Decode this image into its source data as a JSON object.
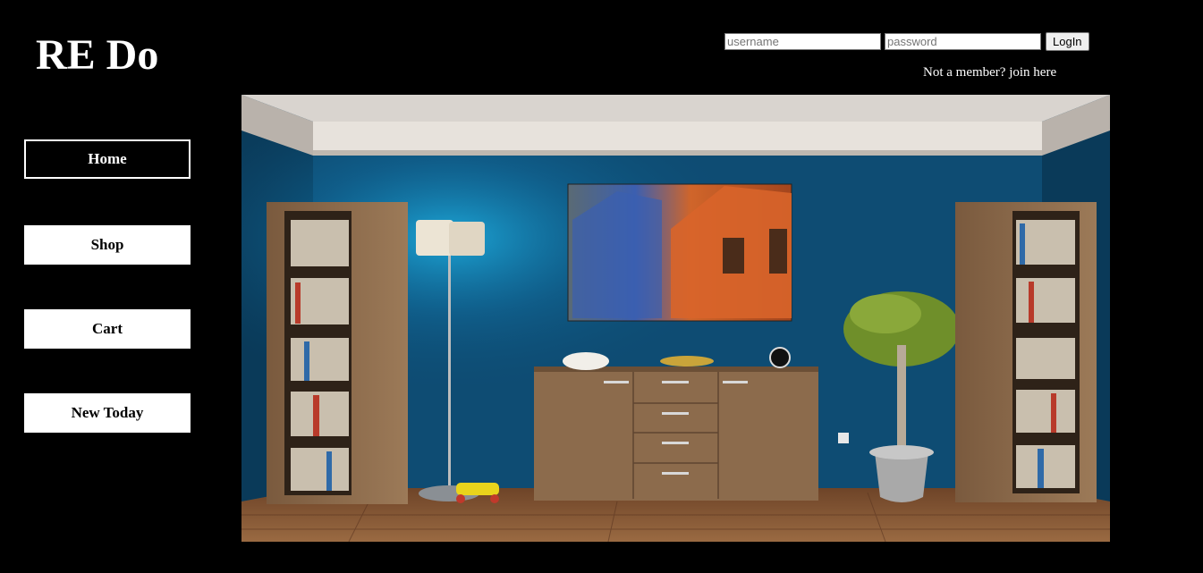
{
  "header": {
    "logo": "RE Do",
    "login": {
      "username_placeholder": "username",
      "password_placeholder": "password",
      "login_label": "LogIn"
    },
    "join_link": "Not a member? join here"
  },
  "nav": {
    "items": [
      {
        "label": "Home",
        "active": true
      },
      {
        "label": "Shop",
        "active": false
      },
      {
        "label": "Cart",
        "active": false
      },
      {
        "label": "New Today",
        "active": false
      }
    ]
  },
  "hero": {
    "description": "living room interior",
    "colors": {
      "wall": "#0e4c73",
      "floor": "#8a5a36",
      "ceiling": "#d9d4cf",
      "cabinet": "#8c6b4c"
    }
  }
}
